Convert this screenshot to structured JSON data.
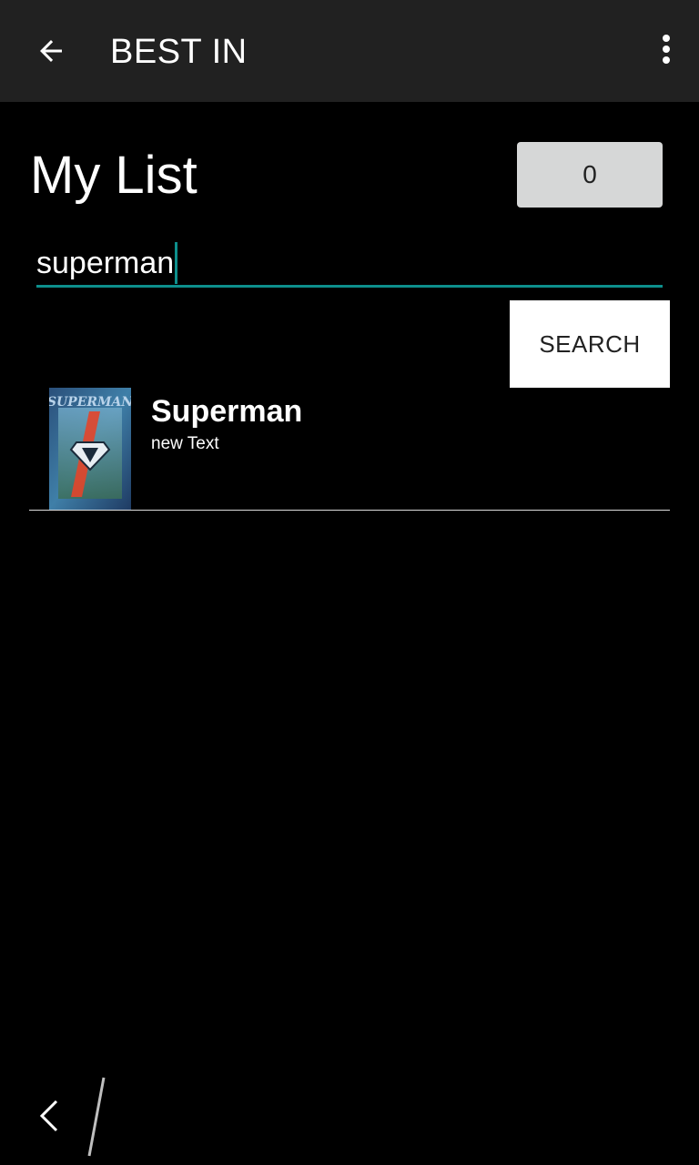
{
  "appbar": {
    "title": "BEST IN",
    "back_icon": "arrow-back-icon",
    "overflow_icon": "more-vert-icon"
  },
  "main": {
    "title": "My List",
    "count": "0",
    "search": {
      "value": "superman",
      "accent_color": "#0d8f8c"
    },
    "search_button_label": "SEARCH",
    "results": [
      {
        "title": "Superman",
        "subtitle": "new Text",
        "poster_icon": "movie-poster"
      }
    ]
  },
  "navbar": {
    "back_icon": "nav-back-icon"
  },
  "colors": {
    "appbar_bg": "#212121",
    "background": "#000000",
    "count_box_bg": "#d6d7d7",
    "button_bg": "#ffffff"
  }
}
